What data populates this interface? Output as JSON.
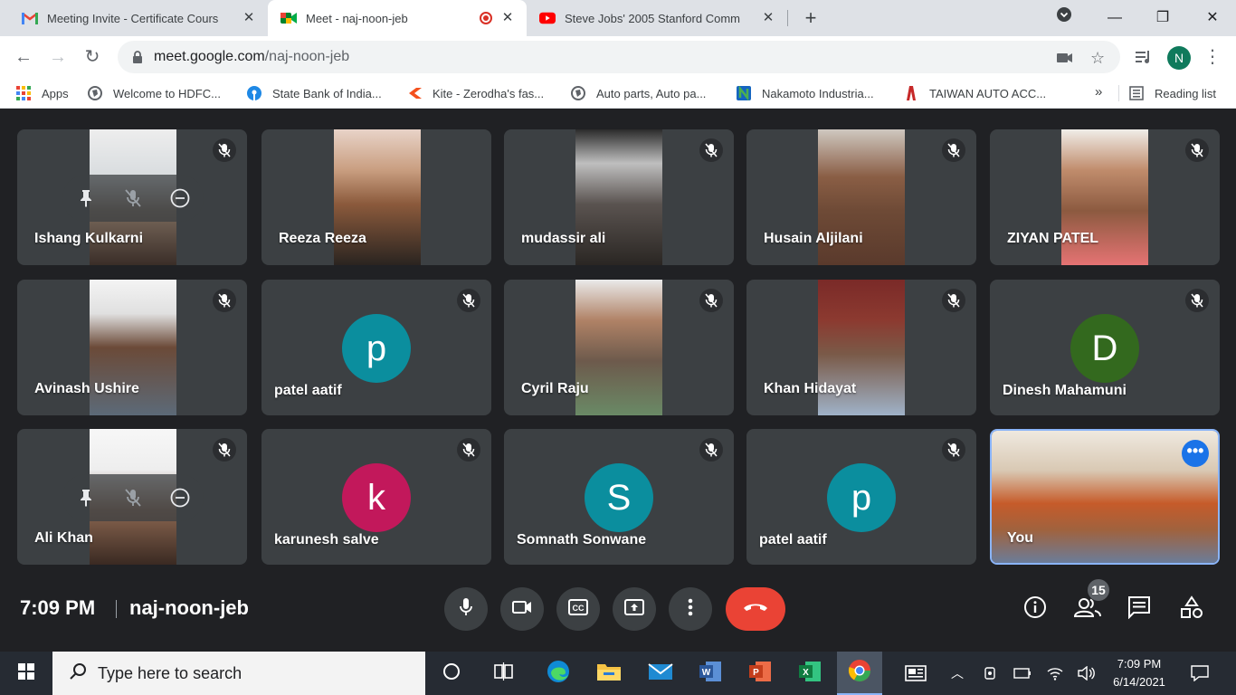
{
  "browser": {
    "tabs": [
      {
        "title": "Meeting Invite - Certificate Cours",
        "icon": "gmail-icon"
      },
      {
        "title": "Meet - naj-noon-jeb",
        "icon": "google-meet-icon",
        "recording": true
      },
      {
        "title": "Steve Jobs' 2005 Stanford Comm",
        "icon": "youtube-icon"
      }
    ],
    "url_host": "meet.google.com",
    "url_path": "/naj-noon-jeb",
    "profile_initial": "N",
    "bookmarks": [
      {
        "label": "Apps"
      },
      {
        "label": "Welcome to HDFC..."
      },
      {
        "label": "State Bank of India..."
      },
      {
        "label": "Kite - Zerodha's fas..."
      },
      {
        "label": "Auto parts, Auto pa..."
      },
      {
        "label": "Nakamoto Industria..."
      },
      {
        "label": "TAIWAN AUTO ACC..."
      }
    ],
    "bookmarks_more": "»",
    "reading_list": "Reading list"
  },
  "meet": {
    "participants": [
      {
        "name": "Ishang Kulkarni",
        "type": "video",
        "muted": true,
        "hovered": true
      },
      {
        "name": "Reeza Reeza",
        "type": "video",
        "muted": false
      },
      {
        "name": "mudassir ali",
        "type": "video",
        "muted": true
      },
      {
        "name": "Husain Aljilani",
        "type": "video",
        "muted": true
      },
      {
        "name": "ZIYAN PATEL",
        "type": "video",
        "muted": true
      },
      {
        "name": "Avinash Ushire",
        "type": "video",
        "muted": true
      },
      {
        "name": "patel aatif",
        "type": "avatar",
        "initial": "p",
        "color": "#0b8e9e",
        "muted": true
      },
      {
        "name": "Cyril Raju",
        "type": "video",
        "muted": true
      },
      {
        "name": "Khan Hidayat",
        "type": "video",
        "muted": true
      },
      {
        "name": "Dinesh Mahamuni",
        "type": "avatar",
        "initial": "D",
        "color": "#33691e",
        "muted": true
      },
      {
        "name": "Ali Khan",
        "type": "video",
        "muted": true,
        "hovered": true
      },
      {
        "name": "karunesh salve",
        "type": "avatar",
        "initial": "k",
        "color": "#c2185b",
        "muted": true
      },
      {
        "name": "Somnath Sonwane",
        "type": "avatar",
        "initial": "S",
        "color": "#0b8e9e",
        "muted": true
      },
      {
        "name": "patel aatif",
        "type": "avatar",
        "initial": "p",
        "color": "#0b8e9e",
        "muted": true
      },
      {
        "name": "You",
        "type": "self",
        "muted": false
      }
    ],
    "time": "7:09 PM",
    "meeting_code": "naj-noon-jeb",
    "participant_count": "15",
    "accent": "#1a73e8",
    "end_call_color": "#ea4335"
  },
  "taskbar": {
    "search_placeholder": "Type here to search",
    "time": "7:09 PM",
    "date": "6/14/2021"
  }
}
